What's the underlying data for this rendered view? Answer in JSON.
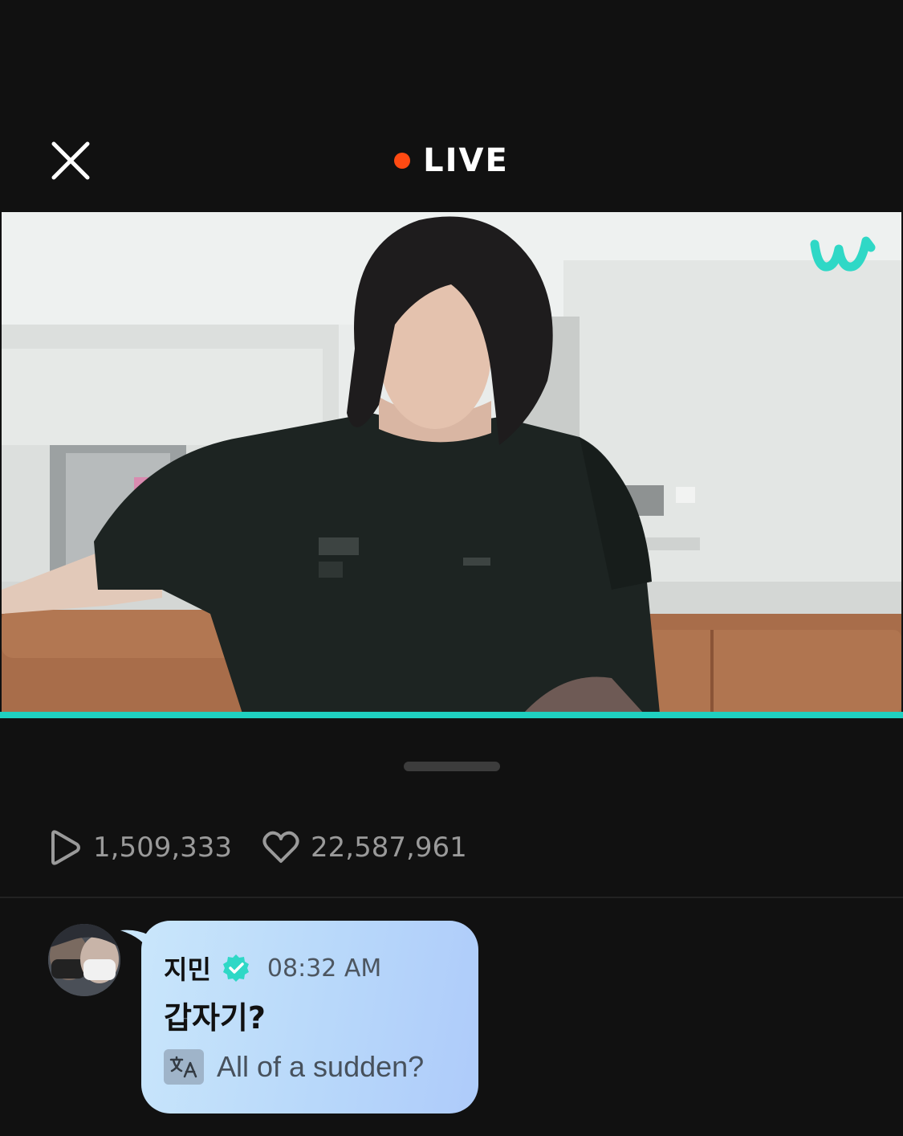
{
  "header": {
    "live_label": "LIVE",
    "live_dot_color": "#ff4a12",
    "close_icon": "close-icon"
  },
  "video": {
    "watermark": "w",
    "watermark_color": "#2fd8c6",
    "progress_fraction": 1.0,
    "progress_color": "#1fd0c0"
  },
  "stats": {
    "views": "1,509,333",
    "likes": "22,587,961",
    "views_icon": "play-icon",
    "likes_icon": "heart-icon"
  },
  "comment": {
    "author": "지민",
    "verified_icon": "verified-badge-icon",
    "time": "08:32 AM",
    "message": "갑자기?",
    "translate_icon": "translate-icon",
    "translation": "All of a sudden?"
  }
}
